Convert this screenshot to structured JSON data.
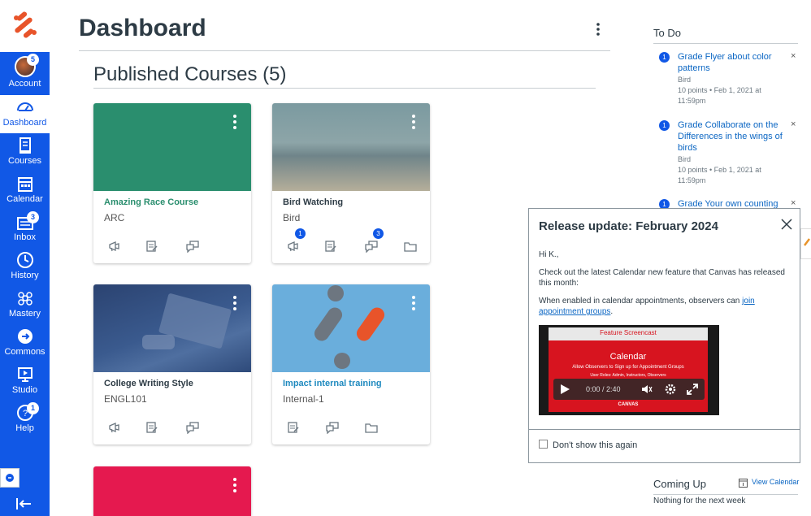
{
  "nav": {
    "account": {
      "label": "Account",
      "badge": "5"
    },
    "dashboard": {
      "label": "Dashboard"
    },
    "courses": {
      "label": "Courses"
    },
    "calendar": {
      "label": "Calendar"
    },
    "inbox": {
      "label": "Inbox",
      "badge": "3"
    },
    "history": {
      "label": "History"
    },
    "mastery": {
      "label": "Mastery"
    },
    "commons": {
      "label": "Commons"
    },
    "studio": {
      "label": "Studio"
    },
    "help": {
      "label": "Help",
      "badge": "1"
    }
  },
  "header": {
    "title": "Dashboard"
  },
  "section": {
    "title": "Published Courses (5)"
  },
  "courses": [
    {
      "title": "Amazing Race Course",
      "code": "ARC",
      "color": "#2a8e6e",
      "title_color": "#2a8e6e"
    },
    {
      "title": "Bird Watching",
      "code": "Bird",
      "color": "#6c8a90",
      "title_color": "#2d3b45",
      "badges": [
        "1",
        "3"
      ]
    },
    {
      "title": "College Writing Style",
      "code": "ENGL101",
      "color": "#2e4a7a",
      "title_color": "#2d3b45"
    },
    {
      "title": "Impact internal training",
      "code": "Internal-1",
      "color": "#5fa8d8",
      "title_color": "#1f8abf"
    },
    {
      "color": "#e5194f"
    }
  ],
  "todo": {
    "title": "To Do",
    "items": [
      {
        "num": "1",
        "title": "Grade Flyer about color patterns",
        "course": "Bird",
        "meta": "10 points • Feb 1, 2021 at 11:59pm"
      },
      {
        "num": "1",
        "title": "Grade Collaborate on the Differences in the wings of birds",
        "course": "Bird",
        "meta": "10 points • Feb 1, 2021 at 11:59pm"
      },
      {
        "num": "1",
        "title": "Grade Your own counting"
      }
    ],
    "dismiss": "×"
  },
  "coming_up": {
    "title": "Coming Up",
    "view_calendar": "View Calendar",
    "empty": "Nothing for the next week"
  },
  "dialog": {
    "title": "Release update: February 2024",
    "greeting": "Hi K.,",
    "p1": "Check out the latest Calendar new feature that Canvas has released this month:",
    "p2_prefix": "When enabled in calendar appointments, observers can ",
    "p2_link": "join appointment groups",
    "p2_suffix": ".",
    "video": {
      "banner": "Feature Screencast",
      "heading": "Calendar",
      "line1": "Allow Observers to Sign up for Appointment Groups",
      "line2": "User Roles: Admin, Instructors, Observers",
      "time": "0:00 / 2:40",
      "brand": "CANVAS"
    },
    "checkbox_label": "Don't show this again"
  },
  "colors": {
    "brand_blue": "#1158e6",
    "link": "#0b66c3",
    "canvas_red": "#d7141f"
  }
}
